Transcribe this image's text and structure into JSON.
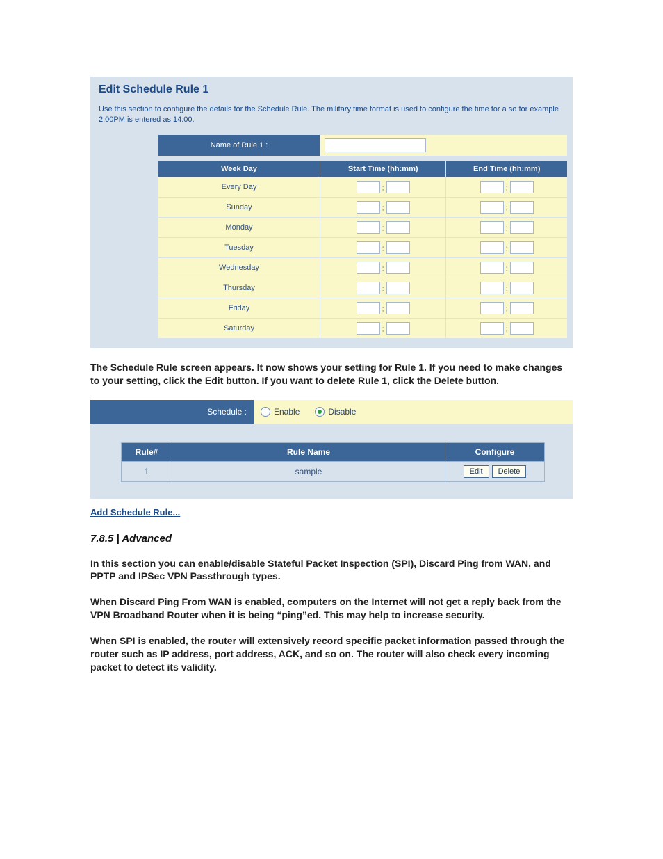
{
  "panel1": {
    "title": "Edit Schedule Rule 1",
    "description": "Use this section to configure the details for the Schedule Rule. The military time format is used to configure the time for a so for example 2:00PM is entered as 14:00.",
    "name_label": "Name of Rule 1 :",
    "name_value": "",
    "columns": {
      "weekday": "Week Day",
      "start": "Start Time (hh:mm)",
      "end": "End Time (hh:mm)"
    },
    "days": [
      "Every Day",
      "Sunday",
      "Monday",
      "Tuesday",
      "Wednesday",
      "Thursday",
      "Friday",
      "Saturday"
    ]
  },
  "midtext": "The Schedule Rule screen appears. It now shows your setting for Rule 1. If you need to make changes to your setting, click the Edit button. If you want to delete Rule 1, click the Delete button.",
  "panel2": {
    "toggle_label": "Schedule :",
    "enable": "Enable",
    "disable": "Disable",
    "selected": "disable",
    "columns": {
      "num": "Rule#",
      "name": "Rule Name",
      "conf": "Configure"
    },
    "rows": [
      {
        "num": "1",
        "name": "sample",
        "edit": "Edit",
        "del": "Delete"
      }
    ],
    "addlink": "Add Schedule Rule..."
  },
  "section": {
    "heading": "7.8.5 | Advanced",
    "p1": "In this section you can enable/disable Stateful Packet Inspection (SPI), Discard Ping from WAN, and PPTP and IPSec VPN Passthrough types.",
    "p2": "When Discard Ping From WAN is enabled, computers on the Internet will not get a reply back from the VPN Broadband Router when it is being “ping”ed. This may help to increase security.",
    "p3": "When SPI is enabled, the router will extensively record specific packet information passed through the router such as IP address, port address, ACK, and so on. The router will also check every incoming packet to detect its validity."
  }
}
